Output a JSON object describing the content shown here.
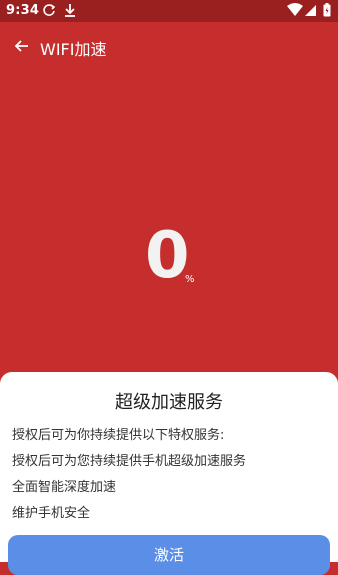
{
  "status_bar": {
    "time": "9:34",
    "icons": [
      "sync-icon",
      "download-icon",
      "wifi-icon",
      "signal-icon",
      "battery-icon"
    ]
  },
  "app_bar": {
    "title": "WIFI加速",
    "back_icon": "back-arrow-icon"
  },
  "speed": {
    "value": "0",
    "unit": "%"
  },
  "dialog": {
    "title": "超级加速服务",
    "lines": [
      "授权后可为你持续提供以下特权服务:",
      "授权后可为您持续提供手机超级加速服务",
      "全面智能深度加速",
      "维护手机安全"
    ],
    "button_label": "激活"
  },
  "colors": {
    "background": "#c62d2d",
    "status_bar": "#9a1f1f",
    "button": "#5b8ee6"
  }
}
